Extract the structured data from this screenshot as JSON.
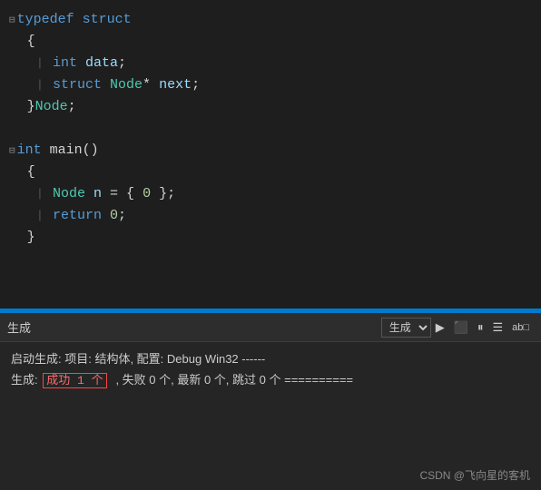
{
  "code": {
    "lines": [
      {
        "indicator": "⊟",
        "parts": [
          {
            "type": "keyword",
            "text": "typedef"
          },
          {
            "type": "text",
            "text": " "
          },
          {
            "type": "keyword",
            "text": "struct"
          }
        ]
      },
      {
        "indicator": "",
        "parts": [
          {
            "type": "punctuation",
            "text": "{"
          }
        ],
        "indent": 0
      },
      {
        "indicator": "|",
        "parts": [
          {
            "type": "keyword",
            "text": "int"
          },
          {
            "type": "text",
            "text": " "
          },
          {
            "type": "member",
            "text": "data"
          },
          {
            "type": "punctuation",
            "text": ";"
          }
        ],
        "indent": 1
      },
      {
        "indicator": "|",
        "parts": [
          {
            "type": "keyword",
            "text": "struct"
          },
          {
            "type": "text",
            "text": " "
          },
          {
            "type": "type-name",
            "text": "Node"
          },
          {
            "type": "text",
            "text": "*"
          },
          {
            "type": "text",
            "text": " "
          },
          {
            "type": "member",
            "text": "next"
          },
          {
            "type": "punctuation",
            "text": ";"
          }
        ],
        "indent": 1
      },
      {
        "indicator": "",
        "parts": [
          {
            "type": "punctuation",
            "text": "}"
          },
          {
            "type": "type-name",
            "text": "Node"
          },
          {
            "type": "punctuation",
            "text": ";"
          }
        ],
        "indent": 0
      },
      {
        "indicator": "",
        "parts": [],
        "indent": 0
      },
      {
        "indicator": "⊟",
        "parts": [
          {
            "type": "keyword",
            "text": "int"
          },
          {
            "type": "text",
            "text": " "
          },
          {
            "type": "text",
            "text": "main"
          },
          {
            "type": "punctuation",
            "text": "()"
          }
        ]
      },
      {
        "indicator": "",
        "parts": [
          {
            "type": "punctuation",
            "text": "{"
          }
        ],
        "indent": 0
      },
      {
        "indicator": "|",
        "parts": [
          {
            "type": "type-name",
            "text": "Node"
          },
          {
            "type": "text",
            "text": " "
          },
          {
            "type": "member",
            "text": "n"
          },
          {
            "type": "text",
            "text": " = { "
          },
          {
            "type": "number",
            "text": "0"
          },
          {
            "type": "text",
            "text": " };"
          }
        ],
        "indent": 1
      },
      {
        "indicator": "|",
        "parts": [
          {
            "type": "keyword",
            "text": "return"
          },
          {
            "type": "text",
            "text": " "
          },
          {
            "type": "number",
            "text": "0"
          },
          {
            "type": "punctuation",
            "text": ";"
          }
        ],
        "indent": 1
      },
      {
        "indicator": "",
        "parts": [
          {
            "type": "punctuation",
            "text": "}"
          }
        ],
        "indent": 0
      }
    ]
  },
  "toolbar": {
    "title": "生成",
    "btn1": "▶",
    "btn2": "⬛",
    "btn3": "⏸",
    "btn4": "☰",
    "btn5": "ab□"
  },
  "output": {
    "line1": "启动生成: 项目: 结构体, 配置: Debug Win32 ------",
    "line2_prefix": "生成: ",
    "line2_highlight": "成功 1 个",
    "line2_suffix": ", 失败 0 个, 最新 0 个, 跳过 0 个 ==========",
    "watermark": "CSDN @飞向星的客机"
  }
}
